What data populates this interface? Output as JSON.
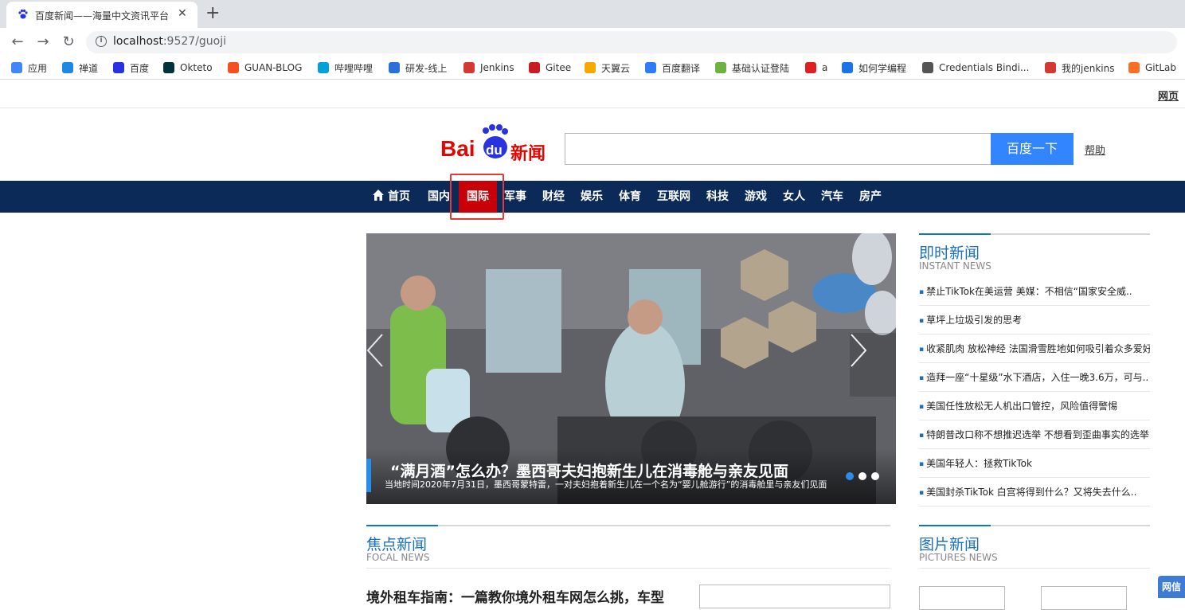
{
  "browser": {
    "tab_title": "百度新闻——海量中文资讯平台",
    "url_host": "localhost",
    "url_path": ":9527/guoji",
    "bookmarks": [
      {
        "label": "应用",
        "icon": "apps-icon",
        "color": "#4285f4"
      },
      {
        "label": "禅道",
        "icon": "zentao-icon",
        "color": "#1e88e5"
      },
      {
        "label": "百度",
        "icon": "baidu-paw-icon",
        "color": "#2932e1"
      },
      {
        "label": "Okteto",
        "icon": "okteto-icon",
        "color": "#00333a"
      },
      {
        "label": "GUAN-BLOG",
        "icon": "guan-blog-icon",
        "color": "#f4511e"
      },
      {
        "label": "哔哩哔哩",
        "icon": "bilibili-icon",
        "color": "#00a1d6"
      },
      {
        "label": "研发-线上",
        "icon": "globe-icon",
        "color": "#2a6fdb"
      },
      {
        "label": "Jenkins",
        "icon": "jenkins-icon",
        "color": "#d33833"
      },
      {
        "label": "Gitee",
        "icon": "gitee-icon",
        "color": "#c71d23"
      },
      {
        "label": "天翼云",
        "icon": "cloud-icon",
        "color": "#f7a800"
      },
      {
        "label": "百度翻译",
        "icon": "translate-icon",
        "color": "#2f7df6"
      },
      {
        "label": "基础认证登陆",
        "icon": "leaf-icon",
        "color": "#6db33f"
      },
      {
        "label": "a",
        "icon": "sc-icon",
        "color": "#e02020"
      },
      {
        "label": "如何学编程",
        "icon": "swirl-icon",
        "color": "#1a73e8"
      },
      {
        "label": "Credentials Bindi...",
        "icon": "world-icon",
        "color": "#555555"
      },
      {
        "label": "我的jenkins",
        "icon": "jenkins-icon",
        "color": "#d33833"
      },
      {
        "label": "GitLab",
        "icon": "gitlab-icon",
        "color": "#fc6d26"
      }
    ]
  },
  "header": {
    "web_link": "网页",
    "logo_text_bai": "Bai",
    "logo_text_du": "du",
    "logo_text_news": "新闻",
    "search_button": "百度一下",
    "help_link": "帮助"
  },
  "nav": {
    "items": [
      "首页",
      "国内",
      "国际",
      "军事",
      "财经",
      "娱乐",
      "体育",
      "互联网",
      "科技",
      "游戏",
      "女人",
      "汽车",
      "房产"
    ],
    "active": "国际",
    "bg_color": "#0b2a57",
    "active_color": "#c80008"
  },
  "slider": {
    "title": "“满月酒”怎么办？墨西哥夫妇抱新生儿在消毒舱与亲友见面",
    "description": "当地时间2020年7月31日，墨西哥蒙特雷，一对夫妇抱着新生儿在一个名为“婴儿舱游行”的消毒舱里与亲友们见面",
    "active_dot": 1,
    "dot_count": 3
  },
  "instant_news": {
    "title_zh": "即时新闻",
    "title_en": "INSTANT NEWS",
    "items": [
      "禁止TikTok在美运营 美媒：不相信“国家安全威..",
      "草坪上垃圾引发的思考",
      "收紧肌肉 放松神经 法国滑雪胜地如何吸引着众多爱好",
      "造拜一座“十星级”水下酒店，入住一晚3.6万，可与..",
      "美国任性放松无人机出口管控，风险值得警惕",
      "特朗普改口称不想推迟选举 不想看到歪曲事实的选举",
      "美国年轻人：拯救TikTok",
      "美国封杀TikTok 白宫将得到什么？又将失去什么.."
    ]
  },
  "focal_news": {
    "title_zh": "焦点新闻",
    "title_en": "FOCAL NEWS",
    "headline": "境外租车指南：一篇教你境外租车网怎么挑，车型"
  },
  "picture_news": {
    "title_zh": "图片新闻",
    "title_en": "PICTURES NEWS"
  },
  "side_badge": "网信"
}
